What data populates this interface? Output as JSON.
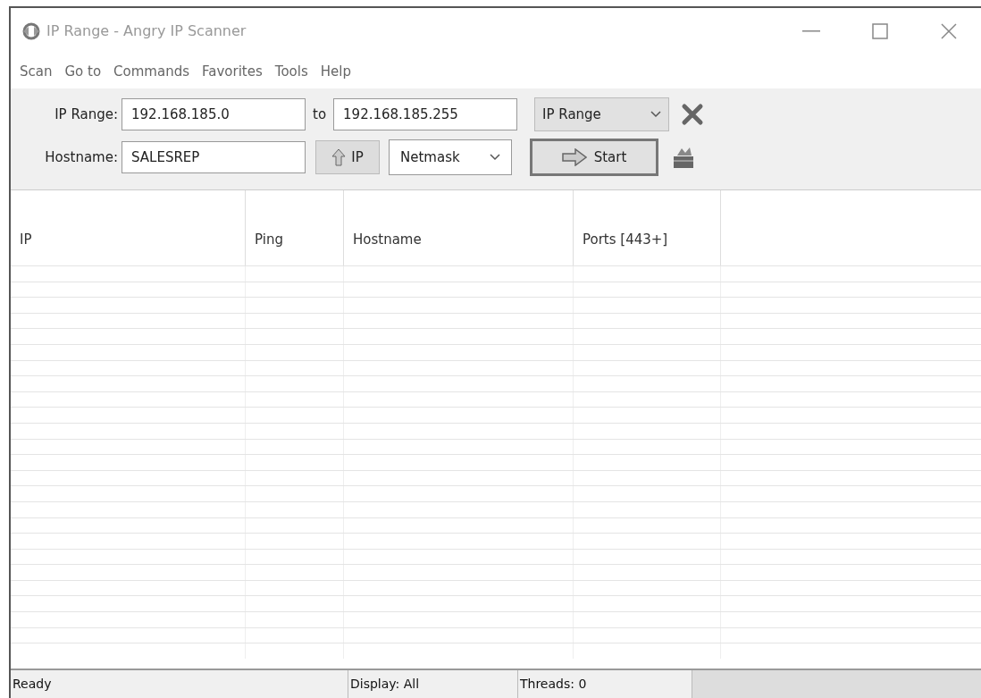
{
  "window": {
    "title": "IP Range - Angry IP Scanner"
  },
  "menu": [
    "Scan",
    "Go to",
    "Commands",
    "Favorites",
    "Tools",
    "Help"
  ],
  "toolbar": {
    "range_label": "IP Range:",
    "range_start": "192.168.185.0",
    "to_label": "to",
    "range_end": "192.168.185.255",
    "feeder": "IP Range",
    "hostname_label": "Hostname:",
    "hostname": "SALESREP",
    "ip_button": "IP",
    "netmask": "Netmask",
    "start_button": "Start"
  },
  "table": {
    "columns": [
      "IP",
      "Ping",
      "Hostname",
      "Ports [443+]"
    ]
  },
  "status_bar": [
    "Ready",
    "Display: All",
    "Threads: 0"
  ]
}
